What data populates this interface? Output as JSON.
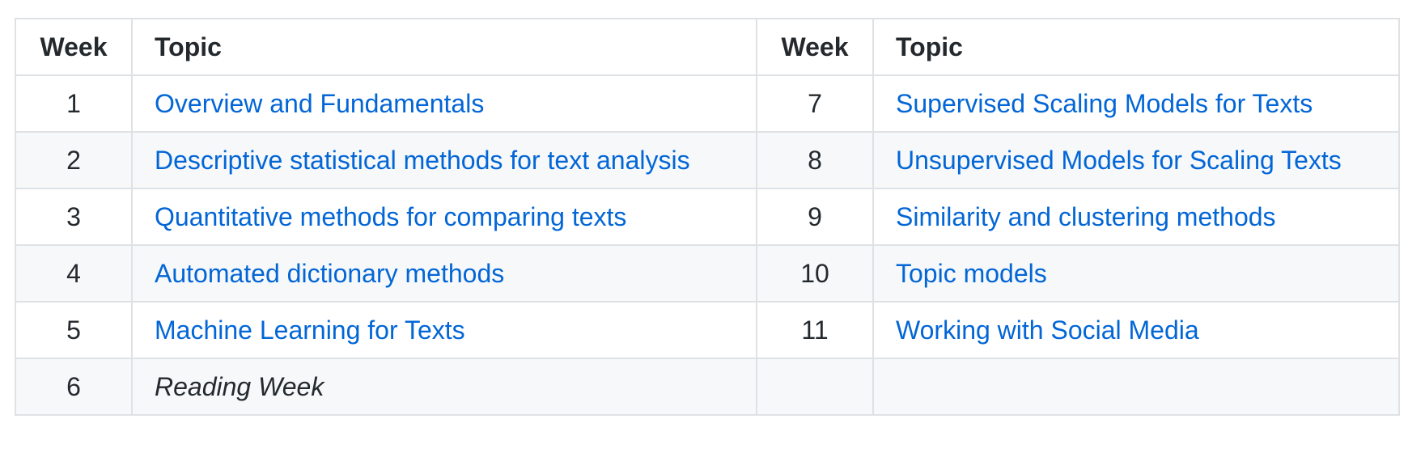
{
  "table": {
    "headers": [
      "Week",
      "Topic",
      "Week",
      "Topic"
    ],
    "rows": [
      {
        "left": {
          "week": "1",
          "topic": "Overview and Fundamentals",
          "link": true
        },
        "right": {
          "week": "7",
          "topic": "Supervised Scaling Models for Texts",
          "link": true
        }
      },
      {
        "left": {
          "week": "2",
          "topic": "Descriptive statistical methods for text analysis",
          "link": true
        },
        "right": {
          "week": "8",
          "topic": "Unsupervised Models for Scaling Texts",
          "link": true
        }
      },
      {
        "left": {
          "week": "3",
          "topic": "Quantitative methods for comparing texts",
          "link": true
        },
        "right": {
          "week": "9",
          "topic": "Similarity and clustering methods",
          "link": true
        }
      },
      {
        "left": {
          "week": "4",
          "topic": "Automated dictionary methods",
          "link": true
        },
        "right": {
          "week": "10",
          "topic": "Topic models",
          "link": true
        }
      },
      {
        "left": {
          "week": "5",
          "topic": "Machine Learning for Texts",
          "link": true
        },
        "right": {
          "week": "11",
          "topic": "Working with Social Media",
          "link": true
        }
      },
      {
        "left": {
          "week": "6",
          "topic": "Reading Week",
          "link": false,
          "italic": true
        },
        "right": {
          "week": "",
          "topic": "",
          "link": false
        }
      }
    ]
  },
  "colors": {
    "link": "#0366d6",
    "text": "#24292e",
    "border": "#dfe2e5",
    "stripe": "#f6f8fa"
  }
}
